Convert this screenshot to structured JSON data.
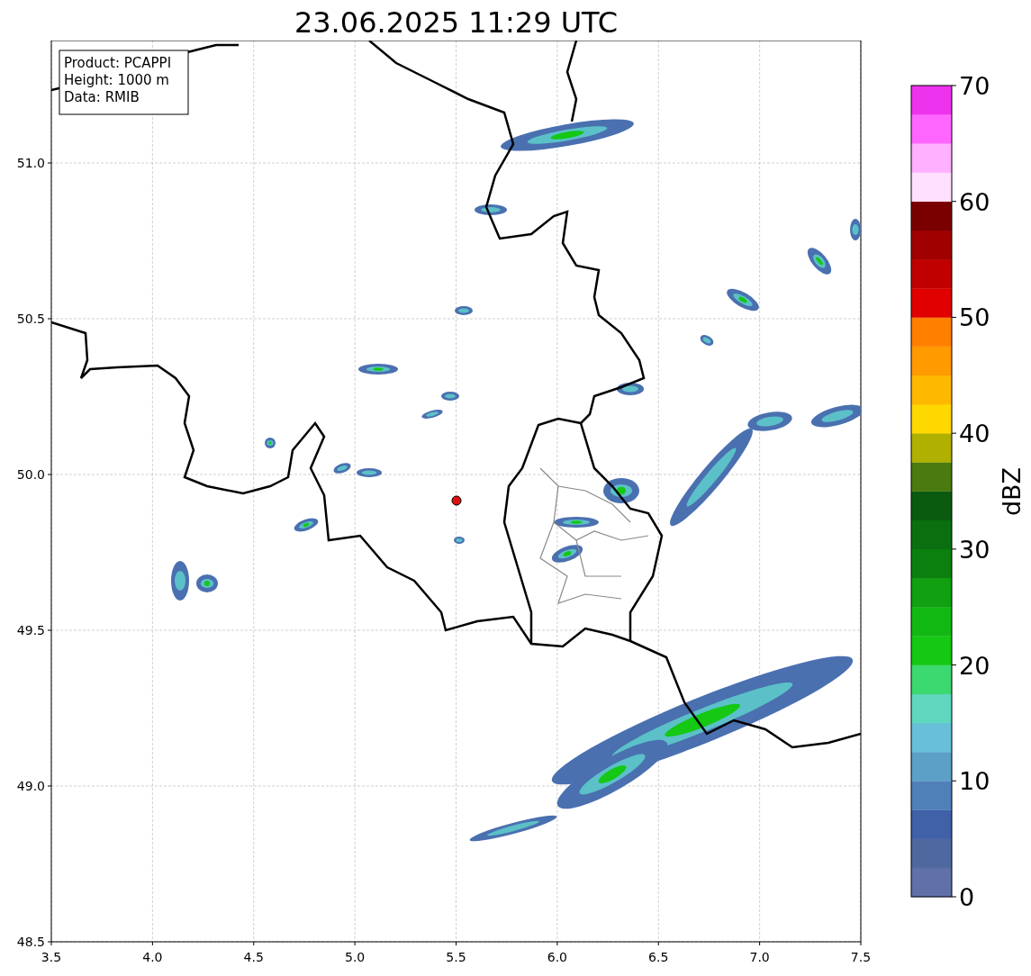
{
  "title": "23.06.2025 11:29 UTC",
  "info_box": {
    "lines": [
      "Product: PCAPPI",
      "Height: 1000 m",
      "Data: RMIB"
    ]
  },
  "map": {
    "x_tick_labels": [
      "3.5",
      "4.0",
      "4.5",
      "5.0",
      "5.5",
      "6.0",
      "6.5",
      "7.0",
      "7.5"
    ],
    "y_tick_labels": [
      "51.0",
      "50.5",
      "50.0",
      "49.5",
      "49.0",
      "48.5"
    ]
  },
  "colorbar": {
    "label": "dBZ",
    "tick_labels": [
      "70",
      "60",
      "50",
      "40",
      "30",
      "20",
      "10",
      "0"
    ],
    "segments": [
      {
        "color": "#6070a8"
      },
      {
        "color": "#5068a0"
      },
      {
        "color": "#4060a8"
      },
      {
        "color": "#5080b8"
      },
      {
        "color": "#5ca0c8"
      },
      {
        "color": "#68c0d8"
      },
      {
        "color": "#60d8c0"
      },
      {
        "color": "#3cd870"
      },
      {
        "color": "#14c814"
      },
      {
        "color": "#12b812"
      },
      {
        "color": "#10a010"
      },
      {
        "color": "#0c800f"
      },
      {
        "color": "#0a700f"
      },
      {
        "color": "#0a5a10"
      },
      {
        "color": "#4a7a10"
      },
      {
        "color": "#b0b000"
      },
      {
        "color": "#ffd800"
      },
      {
        "color": "#ffb800"
      },
      {
        "color": "#ff9a00"
      },
      {
        "color": "#ff7f00"
      },
      {
        "color": "#e00000"
      },
      {
        "color": "#c00000"
      },
      {
        "color": "#a00000"
      },
      {
        "color": "#7a0000"
      },
      {
        "color": "#ffe0ff"
      },
      {
        "color": "#ffb0ff"
      },
      {
        "color": "#ff66ff"
      },
      {
        "color": "#ee33ee"
      }
    ]
  }
}
